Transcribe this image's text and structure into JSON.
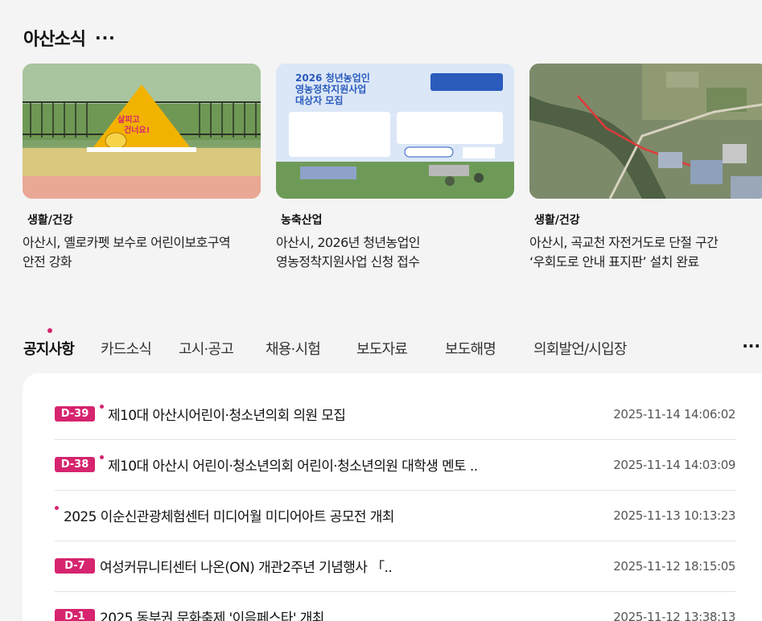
{
  "section": {
    "title": "아산소식",
    "more_label": "···"
  },
  "news_cards": [
    {
      "category": "생활/건강",
      "title_line1": "아산시, 옐로카펫 보수로 어린이보호구역",
      "title_line2": "안전 강화",
      "image_text_line1": "살피고",
      "image_text_line2": "건너요!"
    },
    {
      "category": "농축산업",
      "title_line1": "아산시, 2026년 청년농업인",
      "title_line2": "영농정착지원사업 신청 접수",
      "image_text_line1": "2026 청년농업인",
      "image_text_line2": "영농정착지원사업",
      "image_text_line3": "대상자 모집"
    },
    {
      "category": "생활/건강",
      "title_line1": "아산시, 곡교천 자전거도로 단절 구간",
      "title_line2": "‘우회도로 안내 표지판’ 설치 완료"
    }
  ],
  "tabs": [
    {
      "label": "공지사항"
    },
    {
      "label": "카드소식"
    },
    {
      "label": "고시·공고"
    },
    {
      "label": "채용·시험"
    },
    {
      "label": "보도자료"
    },
    {
      "label": "보도해명"
    },
    {
      "label": "의회발언/시입장"
    }
  ],
  "tabs_more_label": "···",
  "notices": [
    {
      "badge": "D-39",
      "title": "제10대 아산시어린이·청소년의회 의원 모집",
      "date": "2025-11-14 14:06:02"
    },
    {
      "badge": "D-38",
      "title": "제10대 아산시 어린이·청소년의회 어린이·청소년의원 대학생 멘토 ..",
      "date": "2025-11-14 14:03:09"
    },
    {
      "badge": "",
      "title": "2025 이순신관광체험센터 미디어월 미디어아트 공모전 개최",
      "date": "2025-11-13 10:13:23"
    },
    {
      "badge": "D-7",
      "title": "여성커뮤니티센터 나온(ON) 개관2주년 기념행사 「..",
      "date": "2025-11-12 18:15:05"
    },
    {
      "badge": "D-1",
      "title": "2025 동부권 문화축제 '이음페스타' 개최",
      "date": "2025-11-12 13:38:13"
    }
  ],
  "colors": {
    "accent": "#d6246e",
    "background": "#f4f4f4"
  }
}
